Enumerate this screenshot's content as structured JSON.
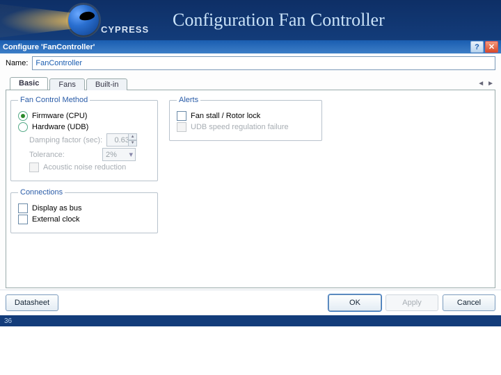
{
  "header": {
    "brand": "CYPRESS",
    "title": "Configuration Fan Controller"
  },
  "dialog": {
    "title": "Configure 'FanController'",
    "name_label": "Name:",
    "name_value": "FanController"
  },
  "tabs": [
    {
      "label": "Basic",
      "active": true
    },
    {
      "label": "Fans",
      "active": false
    },
    {
      "label": "Built-in",
      "active": false
    }
  ],
  "groups": {
    "fan_method": {
      "legend": "Fan Control Method",
      "opt_firmware": "Firmware (CPU)",
      "opt_hardware": "Hardware (UDB)",
      "damping_label": "Damping factor (sec):",
      "damping_value": "0.63",
      "tolerance_label": "Tolerance:",
      "tolerance_value": "2%",
      "acoustic": "Acoustic noise reduction"
    },
    "connections": {
      "legend": "Connections",
      "display_bus": "Display as bus",
      "external_clock": "External clock"
    },
    "alerts": {
      "legend": "Alerts",
      "stall": "Fan stall / Rotor lock",
      "udb": "UDB speed regulation failure"
    }
  },
  "buttons": {
    "datasheet": "Datasheet",
    "ok": "OK",
    "apply": "Apply",
    "cancel": "Cancel"
  },
  "page_number": "36"
}
